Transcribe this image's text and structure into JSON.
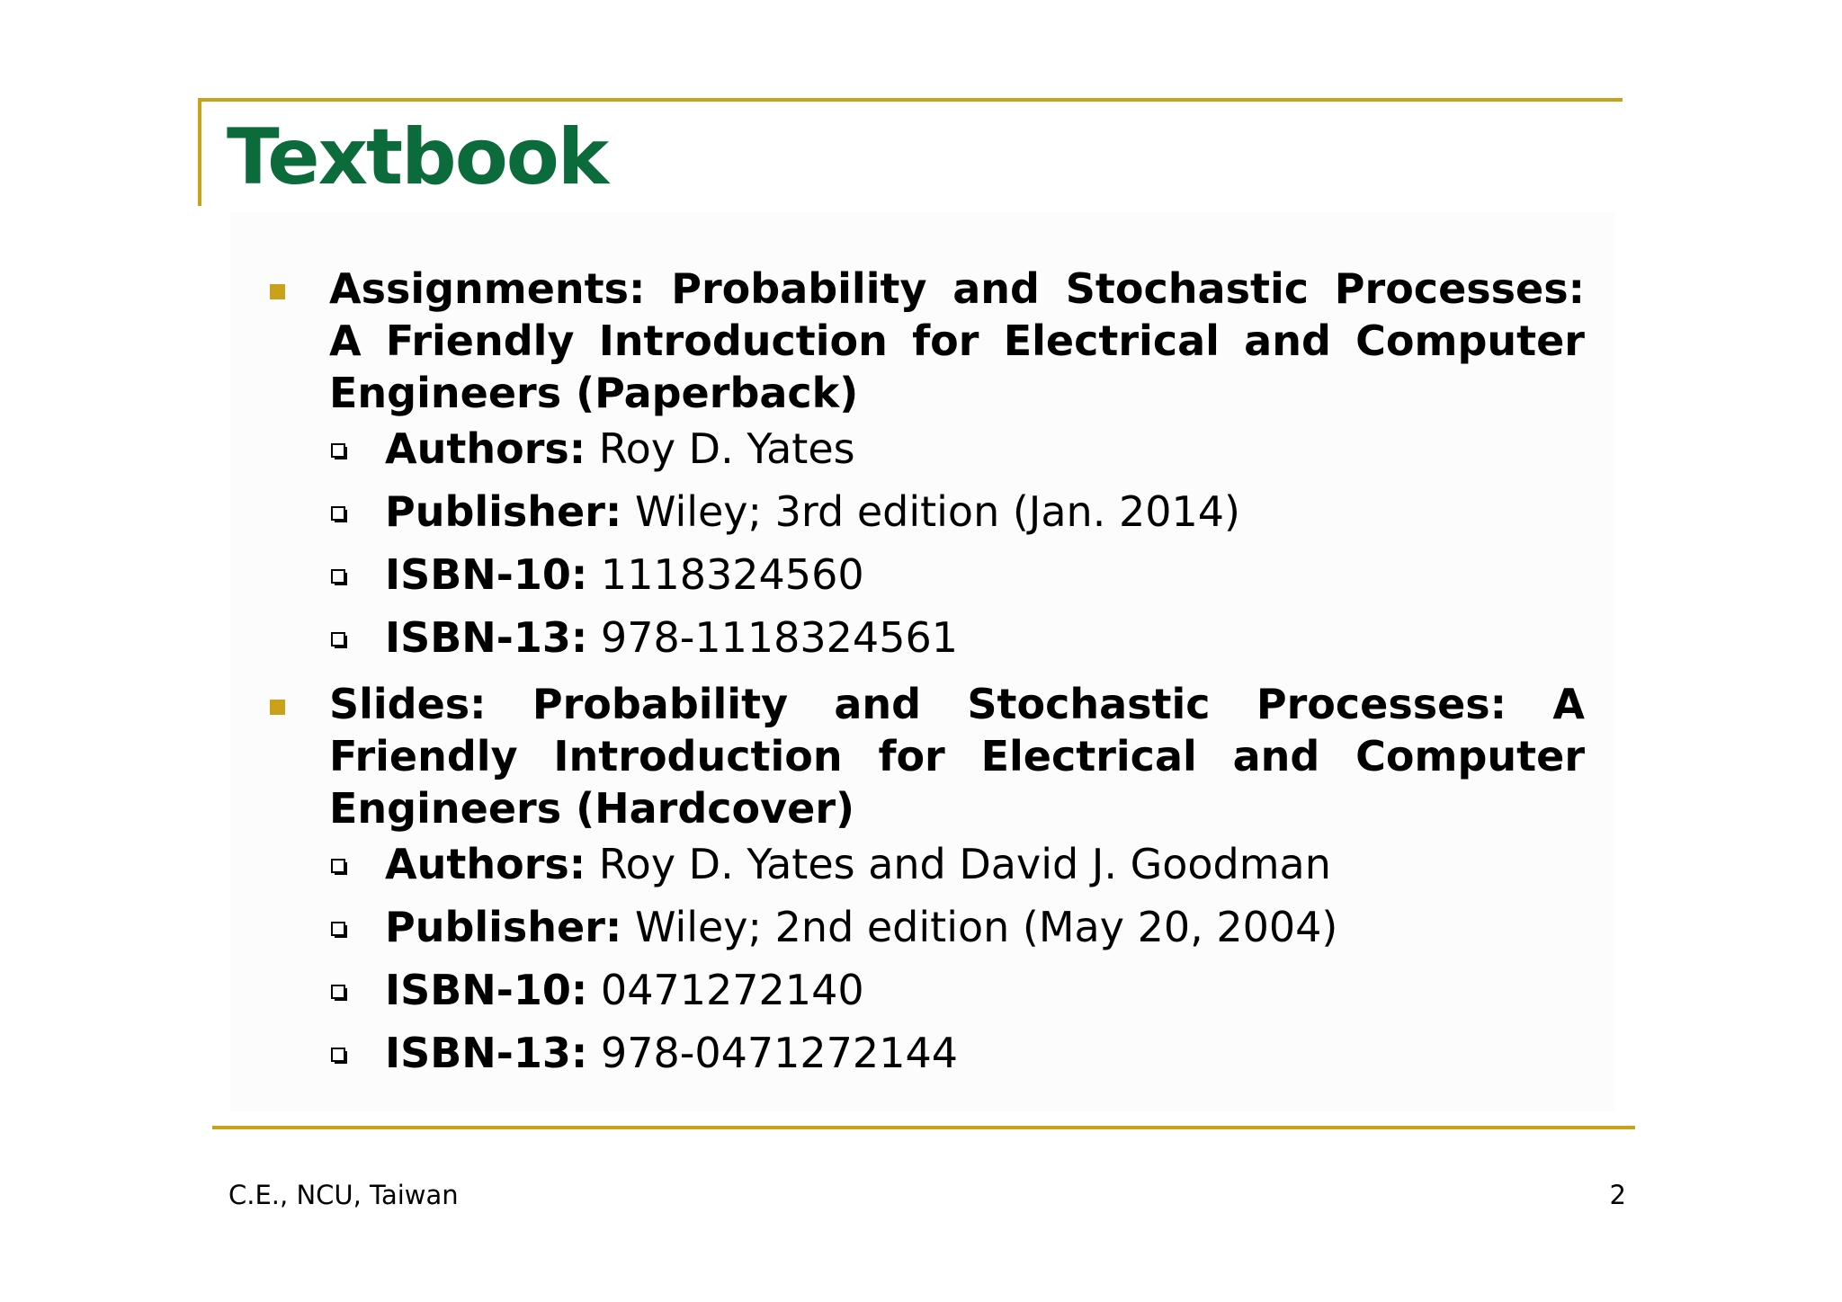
{
  "slide": {
    "title": "Textbook",
    "books": [
      {
        "heading": "Assignments: Probability and Stochastic Processes: A Friendly Introduction for Electrical and Computer Engineers (Paperback)",
        "details": [
          {
            "label": "Authors:",
            "value": " Roy D. Yates"
          },
          {
            "label": "Publisher:",
            "value": " Wiley; 3rd edition (Jan. 2014)"
          },
          {
            "label": "ISBN-10:",
            "value": " 1118324560"
          },
          {
            "label": "ISBN-13:",
            "value": " 978-1118324561"
          }
        ]
      },
      {
        "heading": "Slides: Probability and Stochastic Processes: A Friendly Introduction for Electrical and Computer Engineers (Hardcover)",
        "details": [
          {
            "label": "Authors:",
            "value": " Roy D. Yates and David J. Goodman"
          },
          {
            "label": "Publisher:",
            "value": " Wiley; 2nd edition (May 20, 2004)"
          },
          {
            "label": "ISBN-10:",
            "value": " 0471272140"
          },
          {
            "label": "ISBN-13:",
            "value": " 978-0471272144"
          }
        ]
      }
    ],
    "footer": {
      "left": "C.E., NCU, Taiwan",
      "page_number": "2"
    }
  },
  "colors": {
    "title": "#0B6B3A",
    "accent": "#C9A21A"
  }
}
